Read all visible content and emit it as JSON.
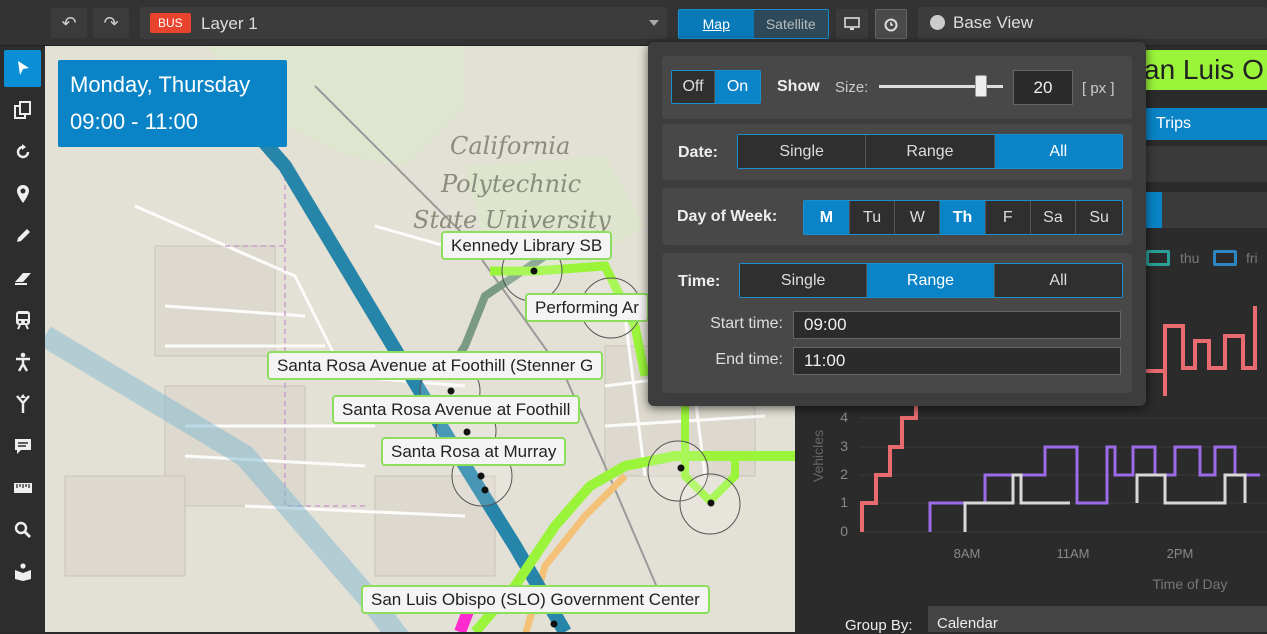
{
  "topbar": {
    "undo_glyph": "↶",
    "redo_glyph": "↷",
    "layer_badge": "BUS",
    "layer_name": "Layer 1",
    "map_label": "Map",
    "satellite_label": "Satellite",
    "base_view_label": "Base View"
  },
  "map": {
    "date_line1": "Monday, Thursday",
    "date_line2": "09:00 - 11:00",
    "poi_lines": [
      "California",
      "Polytechnic",
      "State University"
    ],
    "stops": [
      "Kennedy Library SB",
      "Performing Ar",
      "Santa Rosa Avenue at Foothill (Stenner G",
      "Santa Rosa Avenue at Foothill",
      "Santa Rosa at Murray",
      "San Luis Obispo (SLO) Government Center"
    ],
    "colors": {
      "route_green": "#9af53a",
      "route_blue": "#1f86b0",
      "stop_border": "#8fdd5c",
      "accent": "#0a84c6"
    }
  },
  "popup": {
    "off_label": "Off",
    "on_label": "On",
    "show_label": "Show",
    "size_label": "Size:",
    "size_value": "20",
    "size_unit": "[ px ]",
    "size_slider_fraction": 0.82,
    "date_label": "Date:",
    "date_options": [
      "Single",
      "Range",
      "All"
    ],
    "dow_label": "Day of Week:",
    "dow_options": [
      "M",
      "Tu",
      "W",
      "Th",
      "F",
      "Sa",
      "Su"
    ],
    "time_label": "Time:",
    "time_options": [
      "Single",
      "Range",
      "All"
    ],
    "start_label": "Start time:",
    "start_value": "09:00",
    "end_label": "End time:",
    "end_value": "11:00"
  },
  "right": {
    "title_fragment": "an Luis O",
    "trips_tab": "Trips",
    "legend": [
      {
        "name": "thu",
        "color": "#2aa198"
      },
      {
        "name": "fri",
        "color": "#2e86c1"
      }
    ],
    "y_axis_label": "Vehicles",
    "y_ticks": [
      "4",
      "3",
      "2",
      "1",
      "0"
    ],
    "x_ticks": [
      "8AM",
      "11AM",
      "2PM"
    ],
    "x_axis_label": "Time of Day",
    "group_by_label": "Group By:",
    "group_by_value": "Calendar"
  }
}
